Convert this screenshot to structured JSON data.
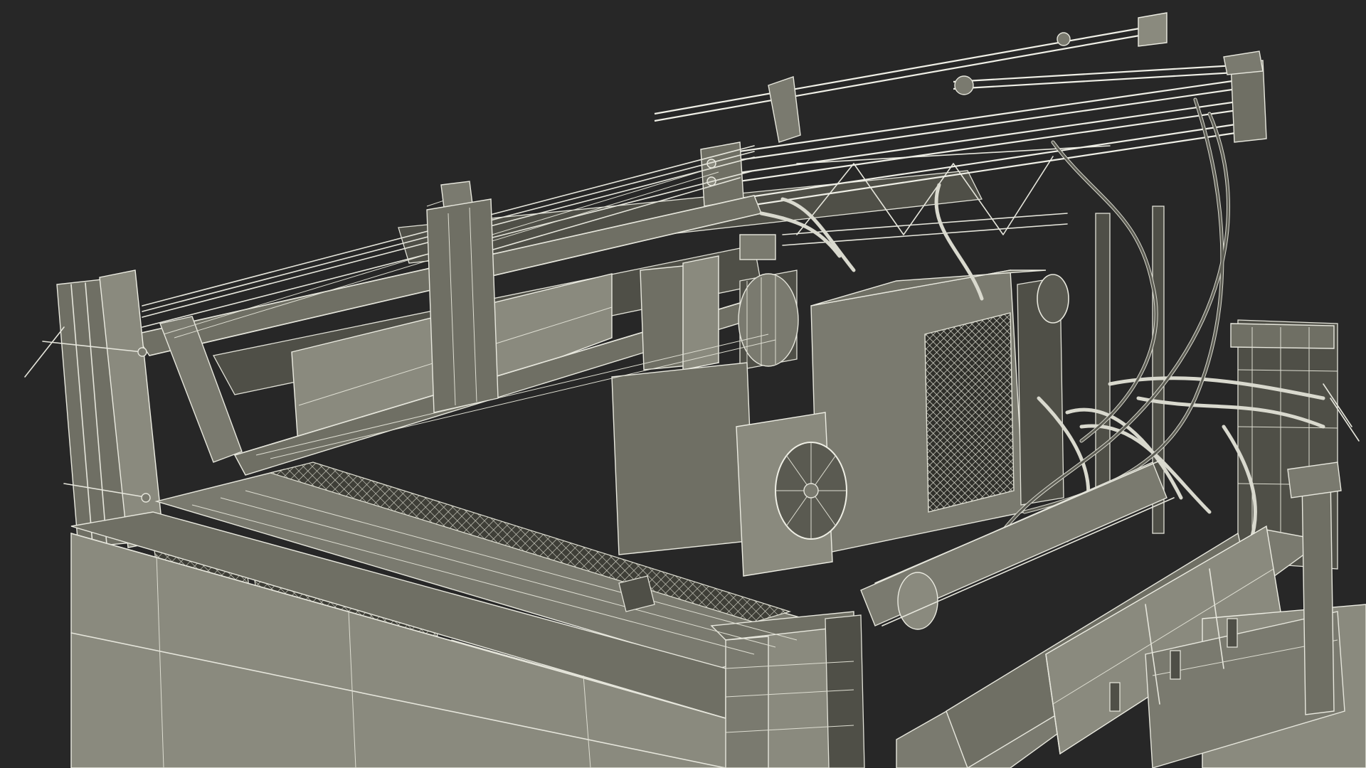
{
  "scene": {
    "colors": {
      "background": "#272727",
      "surface": "#6f6f64",
      "surface_dark": "#4f4f47",
      "surface_light": "#8a8a7e",
      "wireframe": "#e6e6dc"
    }
  }
}
